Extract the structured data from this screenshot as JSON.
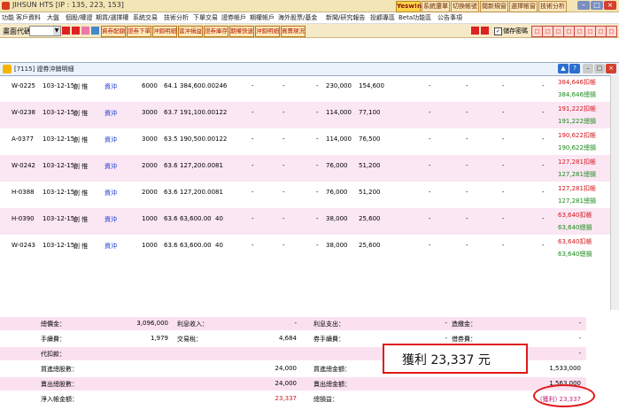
{
  "app": {
    "title": "JIHSUN HTS  [IP : 135, 223, 153]",
    "brand": "Yesw!n",
    "top_buttons": [
      "系統還單",
      "切換帳號",
      "閱新規窗",
      "選擇帳窗",
      "技術分析"
    ]
  },
  "menu": [
    "功能",
    "客戶資料",
    "大盤",
    "個股/權證",
    "期貨/選擇權",
    "系統交易",
    "技術分析",
    "下單交易",
    "證券帳戶",
    "期權帳戶",
    "海外股票/基金",
    "新聞/研究報告",
    "投顧專區",
    "Beta功能區",
    "公告事項"
  ],
  "toolbar": {
    "label": "畫面代碼",
    "buttons": [
      "資券配額",
      "證券下單",
      "沖銷明細",
      "當沖損益",
      "證券庫存",
      "期權快速",
      "沖銷明細",
      "買賣現況"
    ],
    "check_label": "儲存密碼"
  },
  "window": {
    "title": "[7115] 證券沖銷明細"
  },
  "rows": [
    {
      "id": "W-0225",
      "date": "103-12-15",
      "name": "創  惟",
      "type": "資沖",
      "qty": "6000",
      "price": "64.1",
      "amount": "384,600.00",
      "fee": "246",
      "c1": "-",
      "c2": "-",
      "c3": "-",
      "v1": "230,000",
      "v2": "154,600",
      "c4": "-",
      "c5": "-",
      "c6": "-",
      "c7": "-",
      "pl1": "384,646",
      "pl1t": "扣帳",
      "pl2": "384,646",
      "pl2t": "總損"
    },
    {
      "id": "W-0238",
      "date": "103-12-15",
      "name": "創  惟",
      "type": "資沖",
      "qty": "3000",
      "price": "63.7",
      "amount": "191,100.00",
      "fee": "122",
      "c1": "-",
      "c2": "-",
      "c3": "-",
      "v1": "114,000",
      "v2": "77,100",
      "c4": "-",
      "c5": "-",
      "c6": "-",
      "c7": "-",
      "pl1": "191,222",
      "pl1t": "扣帳",
      "pl2": "191,222",
      "pl2t": "總損"
    },
    {
      "id": "A-0377",
      "date": "103-12-15",
      "name": "創  惟",
      "type": "資沖",
      "qty": "3000",
      "price": "63.5",
      "amount": "190,500.00",
      "fee": "122",
      "c1": "-",
      "c2": "-",
      "c3": "-",
      "v1": "114,000",
      "v2": "76,500",
      "c4": "-",
      "c5": "-",
      "c6": "-",
      "c7": "-",
      "pl1": "190,622",
      "pl1t": "扣帳",
      "pl2": "190,622",
      "pl2t": "總損"
    },
    {
      "id": "W-0242",
      "date": "103-12-15",
      "name": "創  惟",
      "type": "資沖",
      "qty": "2000",
      "price": "63.6",
      "amount": "127,200.00",
      "fee": "81",
      "c1": "-",
      "c2": "-",
      "c3": "-",
      "v1": "76,000",
      "v2": "51,200",
      "c4": "-",
      "c5": "-",
      "c6": "-",
      "c7": "-",
      "pl1": "127,281",
      "pl1t": "扣帳",
      "pl2": "127,281",
      "pl2t": "總損"
    },
    {
      "id": "H-0388",
      "date": "103-12-15",
      "name": "創  惟",
      "type": "資沖",
      "qty": "2000",
      "price": "63.6",
      "amount": "127,200.00",
      "fee": "81",
      "c1": "-",
      "c2": "-",
      "c3": "-",
      "v1": "76,000",
      "v2": "51,200",
      "c4": "-",
      "c5": "-",
      "c6": "-",
      "c7": "-",
      "pl1": "127,281",
      "pl1t": "扣帳",
      "pl2": "127,281",
      "pl2t": "總損"
    },
    {
      "id": "H-0390",
      "date": "103-12-15",
      "name": "創  惟",
      "type": "資沖",
      "qty": "1000",
      "price": "63.6",
      "amount": "63,600.00",
      "fee": "40",
      "c1": "-",
      "c2": "-",
      "c3": "-",
      "v1": "38,000",
      "v2": "25,600",
      "c4": "-",
      "c5": "-",
      "c6": "-",
      "c7": "-",
      "pl1": "63,640",
      "pl1t": "扣帳",
      "pl2": "63,640",
      "pl2t": "總損"
    },
    {
      "id": "W-0243",
      "date": "103-12-15",
      "name": "創  惟",
      "type": "資沖",
      "qty": "1000",
      "price": "63.6",
      "amount": "63,600.00",
      "fee": "40",
      "c1": "-",
      "c2": "-",
      "c3": "-",
      "v1": "38,000",
      "v2": "25,600",
      "c4": "-",
      "c5": "-",
      "c6": "-",
      "c7": "-",
      "pl1": "63,640",
      "pl1t": "扣帳",
      "pl2": "63,640",
      "pl2t": "總損"
    }
  ],
  "summary": [
    {
      "a": "總價金：",
      "av": "3,096,000",
      "b": "利息收入：",
      "bv": "-",
      "c": "利息支出：",
      "cv": "-",
      "d": "造繳金：",
      "dv": "-"
    },
    {
      "a": "手續費：",
      "av": "1,979",
      "b": "交易稅：",
      "bv": "4,684",
      "c": "券手續費：",
      "cv": "-",
      "d": "借券費：",
      "dv": "-"
    },
    {
      "a": "代扣款：",
      "av": "",
      "b": "",
      "bv": "",
      "c": "",
      "cv": "",
      "d": "",
      "dv": "-"
    },
    {
      "a": "買進總股數：",
      "av": "",
      "b": "",
      "bv": "24,000",
      "c": "買進總金額：",
      "cv": "",
      "d": "",
      "dv": "1,533,000"
    },
    {
      "a": "賣出總股數：",
      "av": "",
      "b": "",
      "bv": "24,000",
      "c": "賣出總金額：",
      "cv": "",
      "d": "",
      "dv": "1,563,000"
    },
    {
      "a": "淨入帳金額：",
      "av": "",
      "b": "",
      "bv": "23,337",
      "c": "總損益：",
      "cv": "",
      "d": "",
      "dv": "(獲利) 23,337"
    }
  ],
  "callout": "獲利 23,337 元",
  "colors": {
    "accent_red": "#e01818",
    "row_alt": "#fbe6f3",
    "link_blue": "#1a3ccf"
  }
}
